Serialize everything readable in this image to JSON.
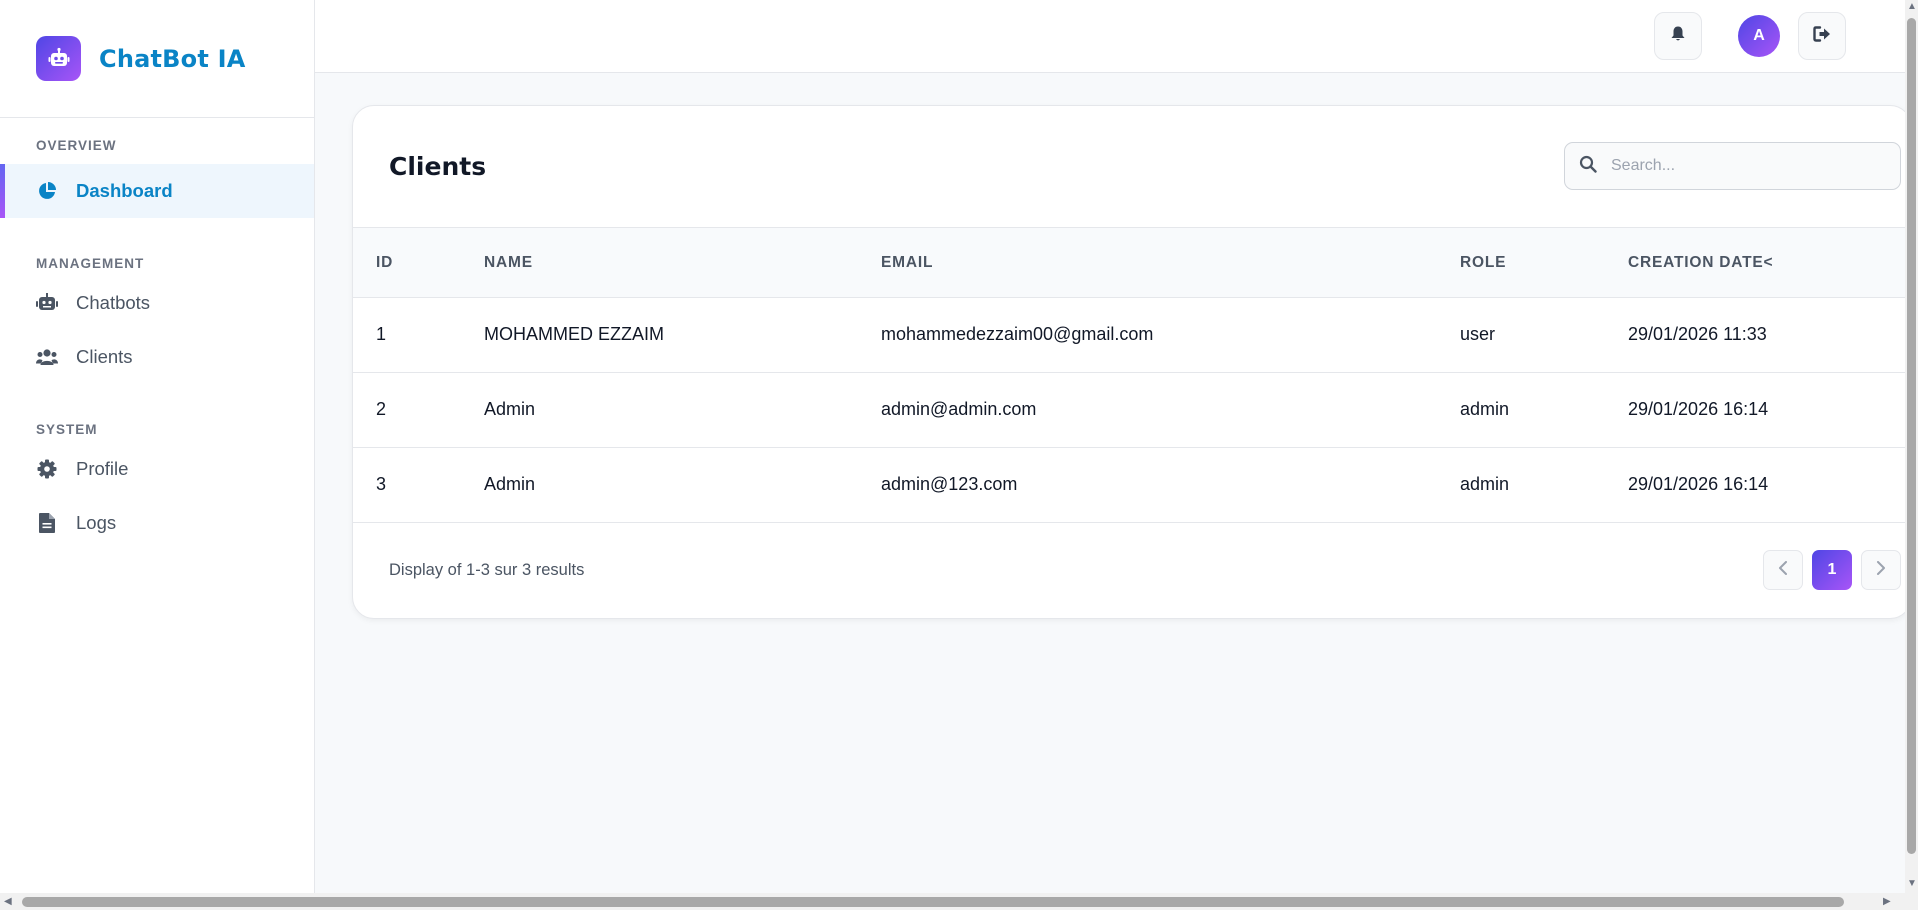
{
  "brand": {
    "title": "ChatBot IA",
    "logo_icon": "robot-icon"
  },
  "sidebar": {
    "sections": [
      {
        "label": "OVERVIEW",
        "items": [
          {
            "label": "Dashboard",
            "icon": "pie-chart-icon",
            "active": true
          }
        ]
      },
      {
        "label": "MANAGEMENT",
        "items": [
          {
            "label": "Chatbots",
            "icon": "robot-icon"
          },
          {
            "label": "Clients",
            "icon": "users-icon"
          }
        ]
      },
      {
        "label": "SYSTEM",
        "items": [
          {
            "label": "Profile",
            "icon": "gear-icon"
          },
          {
            "label": "Logs",
            "icon": "file-icon"
          }
        ]
      }
    ]
  },
  "topbar": {
    "avatar_initial": "A",
    "notification_icon": "bell-icon",
    "logout_icon": "logout-icon"
  },
  "clients": {
    "title": "Clients",
    "search_placeholder": "Search...",
    "columns": [
      "ID",
      "NAME",
      "EMAIL",
      "ROLE",
      "CREATION DATE<"
    ],
    "rows": [
      {
        "id": "1",
        "name": "MOHAMMED EZZAIM",
        "email": "mohammedezzaim00@gmail.com",
        "role": "user",
        "created": "29/01/2026 11:33"
      },
      {
        "id": "2",
        "name": "Admin",
        "email": "admin@admin.com",
        "role": "admin",
        "created": "29/01/2026 16:14"
      },
      {
        "id": "3",
        "name": "Admin",
        "email": "admin@123.com",
        "role": "admin",
        "created": "29/01/2026 16:14"
      }
    ],
    "summary": "Display of 1-3 sur 3 results",
    "pagination": {
      "current_page": "1"
    }
  },
  "colors": {
    "accent": "#0a84c6",
    "gradient_start": "#4f46e5",
    "gradient_end": "#a855f7"
  }
}
